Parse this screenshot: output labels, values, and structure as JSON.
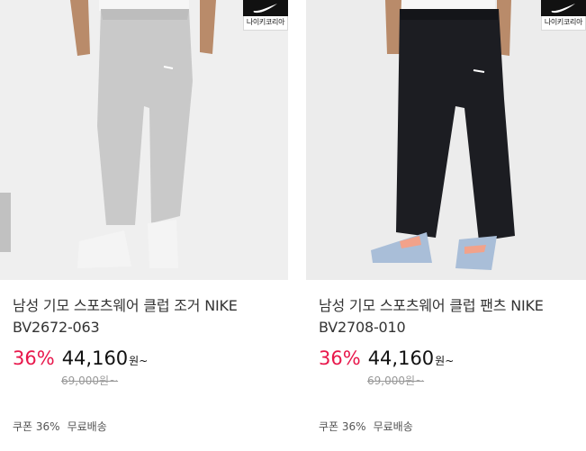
{
  "products": [
    {
      "brand_badge": "나이키코리아",
      "title": "남성 기모 스포츠웨어 클럽 조거 NIKE BV2672-063",
      "discount": "36%",
      "price": "44,160",
      "currency": "원~",
      "original_price": "69,000원~",
      "coupon": "쿠폰 36%",
      "shipping": "무료배송",
      "pants_color": "#c9c9c9",
      "shoe_color": "#f4f4f4"
    },
    {
      "brand_badge": "나이키코리아",
      "title": "남성 기모 스포츠웨어 클럽 팬츠 NIKE BV2708-010",
      "discount": "36%",
      "price": "44,160",
      "currency": "원~",
      "original_price": "69,000원~",
      "coupon": "쿠폰 36%",
      "shipping": "무료배송",
      "pants_color": "#1c1d22",
      "shoe_color": "#a9bed8"
    }
  ],
  "colors": {
    "discount": "#e8174b"
  }
}
